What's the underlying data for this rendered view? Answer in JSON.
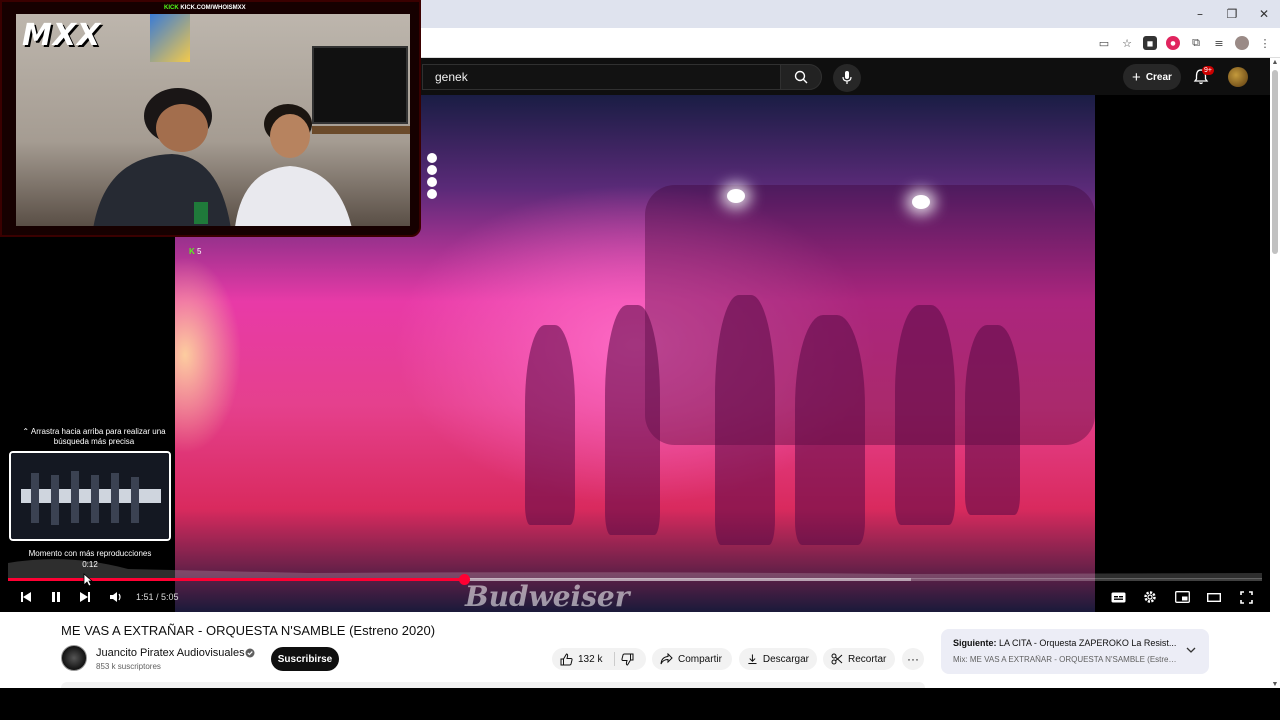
{
  "browser": {
    "window_controls": [
      "–",
      "❐",
      "✕"
    ],
    "extensions": [
      "cast-icon",
      "star-icon",
      "extension-dark-icon",
      "ublock-icon",
      "puzzle-icon",
      "reading-list-icon",
      "profile-avatar",
      "menu-icon"
    ]
  },
  "header": {
    "search_value": "genek",
    "create_label": "Crear",
    "notification_badge": "9+"
  },
  "stream_overlay": {
    "logo": "MXX",
    "kick_tag": "KICK",
    "kick_url": "KICK.COM/WHOISMXX",
    "small_badge": "5"
  },
  "player": {
    "drag_hint": "⌃ Arrastra hacia arriba para realizar una búsqueda más precisa",
    "preview_label": "Momento con más reproducciones",
    "preview_time": "0:12",
    "current_time": "1:51",
    "duration": "5:05",
    "time_display": "1:51 / 5:05",
    "progress_fraction": 0.364,
    "buffered_fraction": 0.72,
    "watermark": "Budweiser"
  },
  "video": {
    "title": "ME VAS A EXTRAÑAR - ORQUESTA N'SAMBLE (Estreno 2020)",
    "channel_name": "Juancito Piratex Audiovisuales",
    "subscribers": "853 k suscriptores",
    "subscribe_label": "Suscribirse",
    "likes": "132 k",
    "share_label": "Compartir",
    "download_label": "Descargar",
    "clip_label": "Recortar",
    "more_label": "···"
  },
  "up_next": {
    "prefix": "Siguiente:",
    "title": "LA CITA - Orquesta ZAPEROKO La Resist...",
    "playlist": "Mix: ME VAS A EXTRAÑAR - ORQUESTA N'SAMBLE (Estreno..."
  },
  "colors": {
    "youtube_red": "#ff0033",
    "kick_green": "#53fc18",
    "dark_bg": "#0f0f0f"
  }
}
